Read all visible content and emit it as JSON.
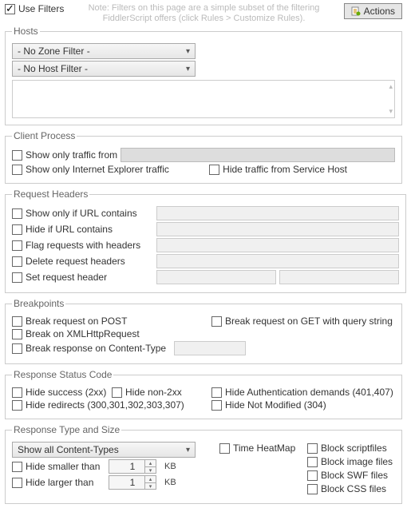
{
  "top": {
    "useFilters": "Use Filters",
    "note": "Note: Filters on this page are a simple subset of the filtering FiddlerScript offers (click Rules > Customize Rules).",
    "actions": "Actions"
  },
  "hosts": {
    "legend": "Hosts",
    "zoneFilter": "- No Zone Filter -",
    "hostFilter": "- No Host Filter -"
  },
  "clientProcess": {
    "legend": "Client Process",
    "showOnlyTrafficFrom": "Show only traffic from",
    "showOnlyIE": "Show only Internet Explorer traffic",
    "hideServiceHost": "Hide traffic from Service Host"
  },
  "requestHeaders": {
    "legend": "Request Headers",
    "showOnlyIfURL": "Show only if URL contains",
    "hideIfURL": "Hide if URL contains",
    "flagWithHeaders": "Flag requests with headers",
    "deleteHeaders": "Delete request headers",
    "setHeader": "Set request header"
  },
  "breakpoints": {
    "legend": "Breakpoints",
    "breakOnPOST": "Break request on POST",
    "breakOnGET": "Break request on GET with query string",
    "breakOnXHR": "Break on XMLHttpRequest",
    "breakOnContentType": "Break response on Content-Type"
  },
  "responseStatus": {
    "legend": "Response Status Code",
    "hide2xx": "Hide success (2xx)",
    "hideNon2xx": "Hide non-2xx",
    "hideAuth": "Hide Authentication demands (401,407)",
    "hideRedirects": "Hide redirects (300,301,302,303,307)",
    "hideNotModified": "Hide Not Modified (304)"
  },
  "responseType": {
    "legend": "Response Type and Size",
    "showAllContentTypes": "Show all Content-Types",
    "hideSmaller": "Hide smaller than",
    "hideLarger": "Hide larger than",
    "kb": "KB",
    "spinnerValue": "1",
    "timeHeatMap": "Time HeatMap",
    "blockScript": "Block scriptfiles",
    "blockImage": "Block image files",
    "blockSWF": "Block SWF files",
    "blockCSS": "Block CSS files"
  }
}
